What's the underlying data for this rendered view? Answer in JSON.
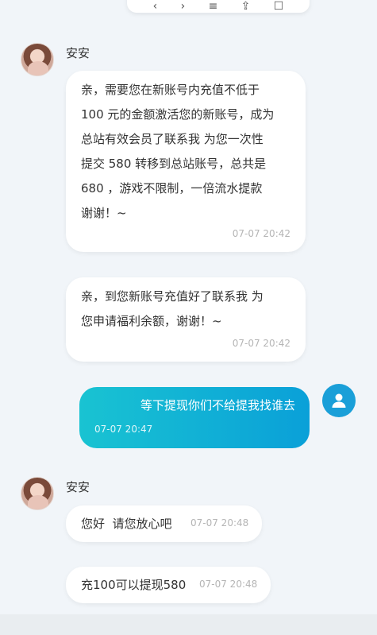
{
  "toolbar": {
    "icons": [
      "back-icon",
      "forward-icon",
      "menu-icon",
      "share-icon",
      "copy-icon"
    ],
    "glyphs": [
      "‹",
      "›",
      "≡",
      "⇪",
      "☐"
    ]
  },
  "messages": [
    {
      "sender": "安安",
      "text": "亲，需要您在新账号内充值不低于\n100 元的金额激活您的新账号，成为\n总站有效会员了联系我 为您一次性\n提交 580 转移到总站账号，总共是\n680 ，游戏不限制，一倍流水提款\n谢谢！~",
      "time": "07-07 20:42"
    },
    {
      "text": "亲，到您新账号充值好了联系我 为\n您申请福利余额，谢谢！~",
      "time": "07-07 20:42"
    },
    {
      "text": "等下提现你们不给提我找谁去",
      "time": "07-07 20:47"
    },
    {
      "sender": "安安",
      "text": "您好  请您放心吧",
      "time": "07-07 20:48"
    },
    {
      "text": "充100可以提现580",
      "time": "07-07 20:48"
    }
  ],
  "colors": {
    "background": "#f1f5f9",
    "self_bubble_start": "#19c3d2",
    "self_bubble_end": "#0aa0d8",
    "user_avatar": "#1a9fd8"
  }
}
